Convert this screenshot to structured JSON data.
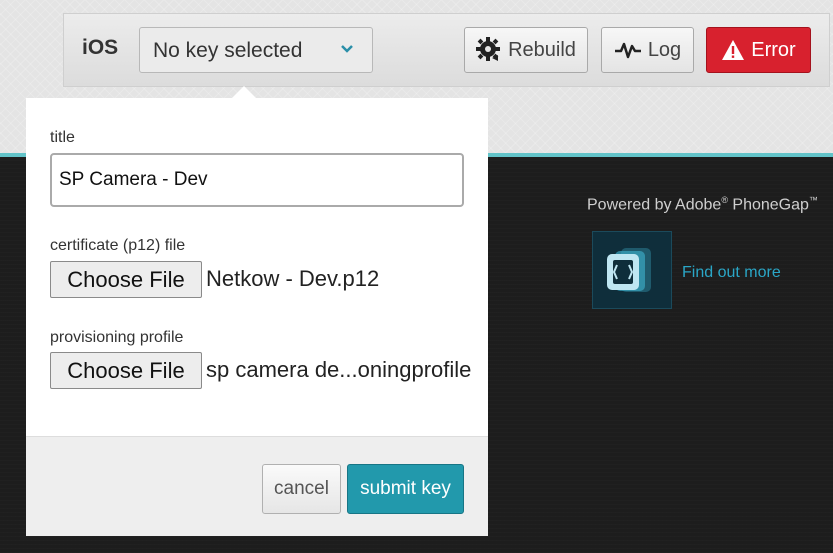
{
  "toolbar": {
    "platform": "iOS",
    "key_select_value": "No key selected",
    "rebuild_label": "Rebuild",
    "log_label": "Log",
    "error_label": "Error"
  },
  "form": {
    "title_label": "title",
    "title_value": "SP Camera - Dev",
    "certificate_label": "certificate (p12) file",
    "certificate_button": "Choose File",
    "certificate_file": "Netkow - Dev.p12",
    "provisioning_label": "provisioning profile",
    "provisioning_button": "Choose File",
    "provisioning_file": "sp camera de...oningprofile",
    "cancel_label": "cancel",
    "submit_label": "submit key"
  },
  "sidebar": {
    "powered_prefix": "Powered by Adobe",
    "powered_suffix": " PhoneGap",
    "find_out_more": "Find out more"
  },
  "colors": {
    "accent_teal": "#62c3c8",
    "submit_blue": "#2299ac",
    "error_red": "#d8212e",
    "link_blue": "#2aa6c6"
  },
  "icons": [
    "chevron-down-icon",
    "gear-refresh-icon",
    "activity-pulse-icon",
    "warning-triangle-icon",
    "phonegap-logo-icon"
  ]
}
